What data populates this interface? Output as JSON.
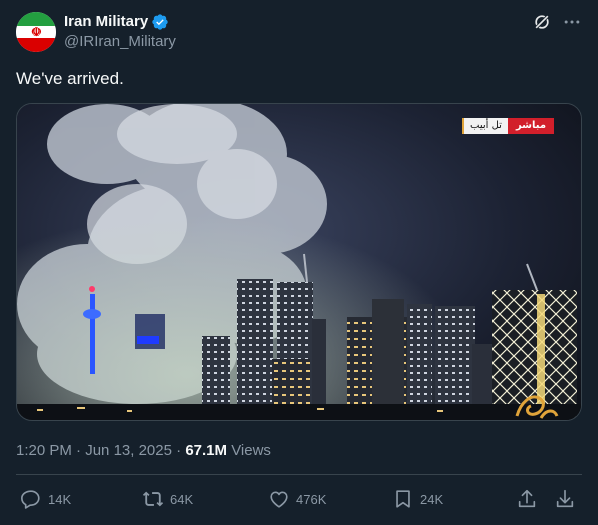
{
  "author": {
    "display_name": "Iran Military",
    "handle": "@IRIran_Military"
  },
  "tweet": {
    "text": "We've arrived."
  },
  "media": {
    "overlay_live": "مباشر",
    "overlay_location": "تل أبيب"
  },
  "meta": {
    "time": "1:20 PM",
    "separator": "·",
    "date": "Jun 13, 2025",
    "views_count": "67.1M",
    "views_label": "Views"
  },
  "actions": {
    "replies": "14K",
    "reposts": "64K",
    "likes": "476K",
    "bookmarks": "24K"
  },
  "colors": {
    "background": "#15202b",
    "text": "#f7f9f9",
    "muted": "#8b98a5",
    "verified": "#1d9bf0",
    "border": "#38444d"
  },
  "icons": [
    "verified-badge-icon",
    "grok-icon",
    "more-icon",
    "reply-icon",
    "repost-icon",
    "like-icon",
    "bookmark-icon",
    "share-icon",
    "download-icon"
  ]
}
